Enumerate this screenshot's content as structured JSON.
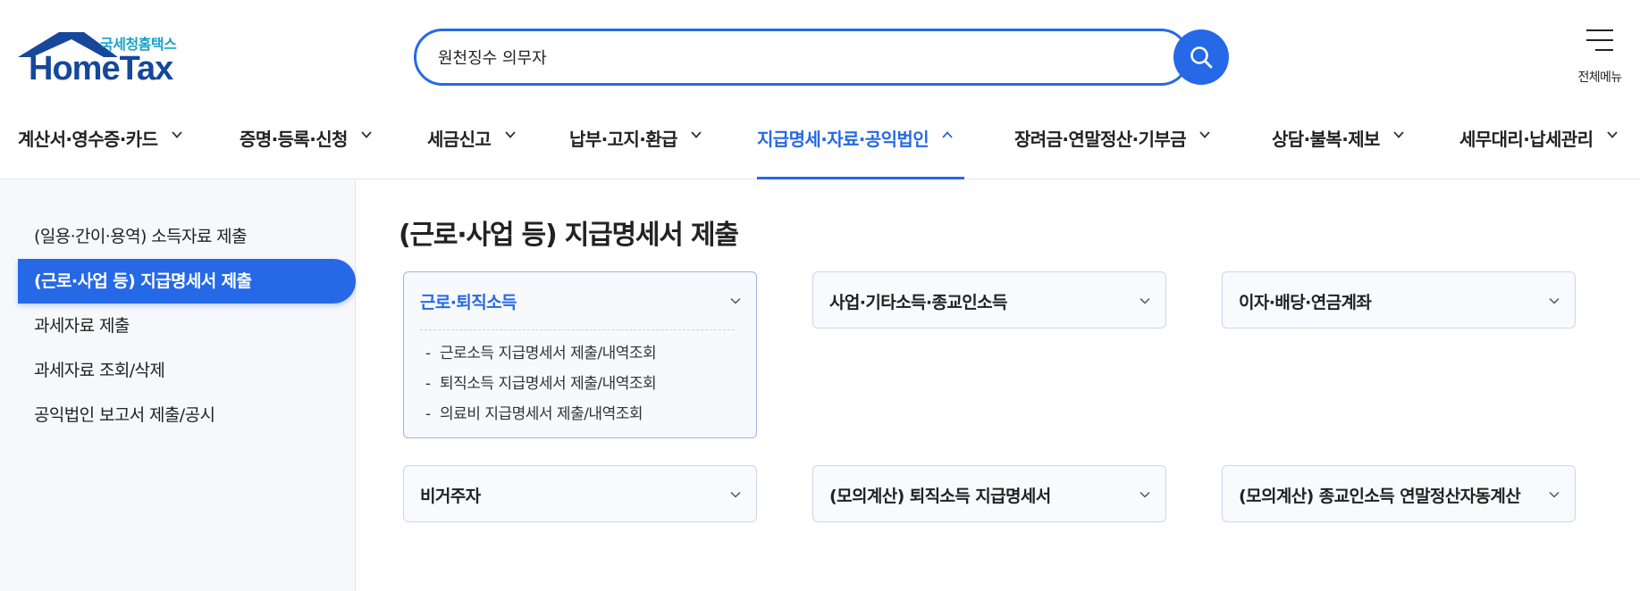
{
  "header": {
    "logo": {
      "title_kr": "국세청홈택스",
      "title_en": "HomeTax"
    },
    "search": {
      "value": "원천징수 의무자"
    },
    "all_menu_label": "전체메뉴"
  },
  "gnb": {
    "items": [
      {
        "label": "계산서·영수증·카드"
      },
      {
        "label": "증명·등록·신청"
      },
      {
        "label": "세금신고"
      },
      {
        "label": "납부·고지·환급"
      },
      {
        "label": "지급명세·자료·공익법인",
        "active": true
      },
      {
        "label": "장려금·연말정산·기부금"
      },
      {
        "label": "상담·불복·제보"
      },
      {
        "label": "세무대리·납세관리"
      }
    ]
  },
  "sidebar": {
    "items": [
      {
        "label": "(일용·간이·용역) 소득자료 제출"
      },
      {
        "label": "(근로·사업 등) 지급명세서 제출",
        "active": true
      },
      {
        "label": "과세자료 제출"
      },
      {
        "label": "과세자료 조회/삭제"
      },
      {
        "label": "공익법인 보고서 제출/공시"
      }
    ]
  },
  "main": {
    "title": "(근로·사업 등) 지급명세서 제출",
    "cards": [
      {
        "title": "근로·퇴직소득",
        "expanded": true,
        "items": [
          {
            "dash": "-",
            "label": "근로소득 지급명세서 제출/내역조회"
          },
          {
            "dash": "-",
            "label": "퇴직소득 지급명세서 제출/내역조회"
          },
          {
            "dash": "-",
            "label": "의료비 지급명세서 제출/내역조회"
          }
        ]
      },
      {
        "title": "사업·기타소득·종교인소득",
        "expanded": false
      },
      {
        "title": "이자·배당·연금계좌",
        "expanded": false
      },
      {
        "title": "비거주자",
        "expanded": false
      },
      {
        "title": "(모의계산) 퇴직소득 지급명세서",
        "expanded": false
      },
      {
        "title": "(모의계산) 종교인소득 연말정산자동계산",
        "expanded": false
      }
    ]
  },
  "colors": {
    "accent": "#2669e6",
    "logo_navy": "#16479a",
    "logo_teal": "#1aa3c9",
    "sidebar_bg": "#f6f8fb",
    "card_border": "#c9d8ec"
  },
  "icons": {
    "search": "search-icon",
    "menu": "hamburger-icon",
    "collapsed": "chevron-down-icon",
    "expanded": "chevron-up-icon",
    "logo": "house-roof-icon"
  }
}
